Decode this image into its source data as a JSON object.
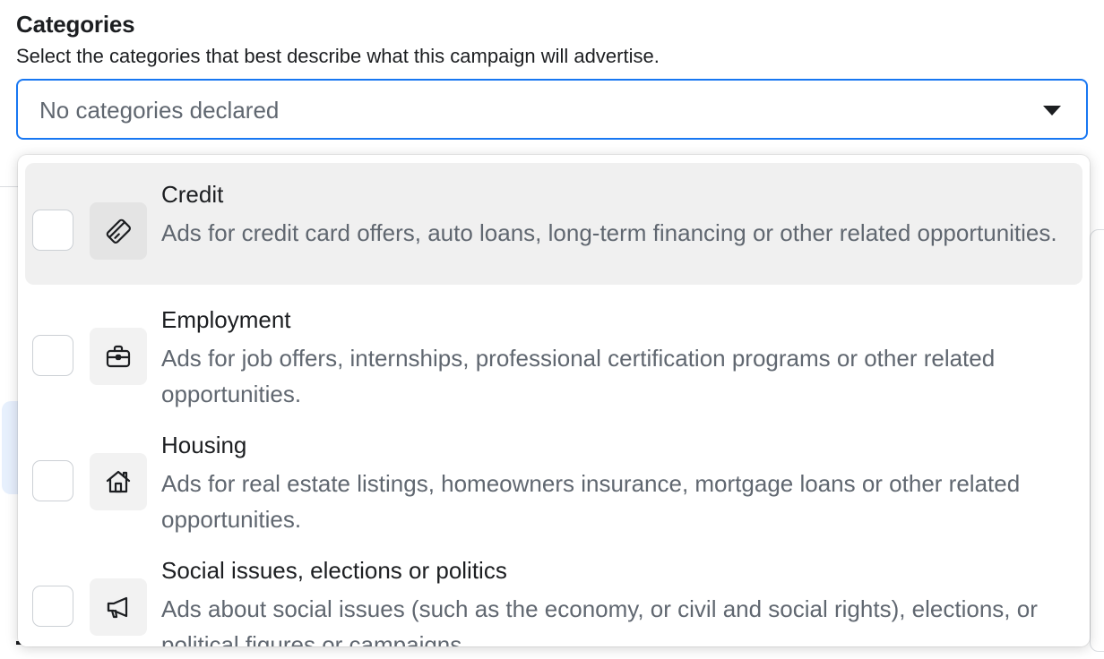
{
  "section": {
    "title": "Categories",
    "subtitle": "Select the categories that best describe what this campaign will advertise."
  },
  "select": {
    "value": "No categories declared",
    "caret_icon": "caret-down-icon"
  },
  "colors": {
    "focus_border": "#1877f2",
    "hover_bg": "#f0f0f0",
    "muted_text": "#606770"
  },
  "options": [
    {
      "title": "Credit",
      "description": "Ads for credit card offers, auto loans, long-term financing or other related opportunities.",
      "icon": "credit-card-icon",
      "checked": false,
      "hovered": true
    },
    {
      "title": "Employment",
      "description": "Ads for job offers, internships, professional certification programs or other related opportunities.",
      "icon": "briefcase-icon",
      "checked": false,
      "hovered": false
    },
    {
      "title": "Housing",
      "description": "Ads for real estate listings, homeowners insurance, mortgage loans or other related opportunities.",
      "icon": "house-icon",
      "checked": false,
      "hovered": false
    },
    {
      "title": "Social issues, elections or politics",
      "description": "Ads about social issues (such as the economy, or civil and social rights), elections, or political figures or campaigns.",
      "icon": "megaphone-icon",
      "checked": false,
      "hovered": false
    }
  ]
}
